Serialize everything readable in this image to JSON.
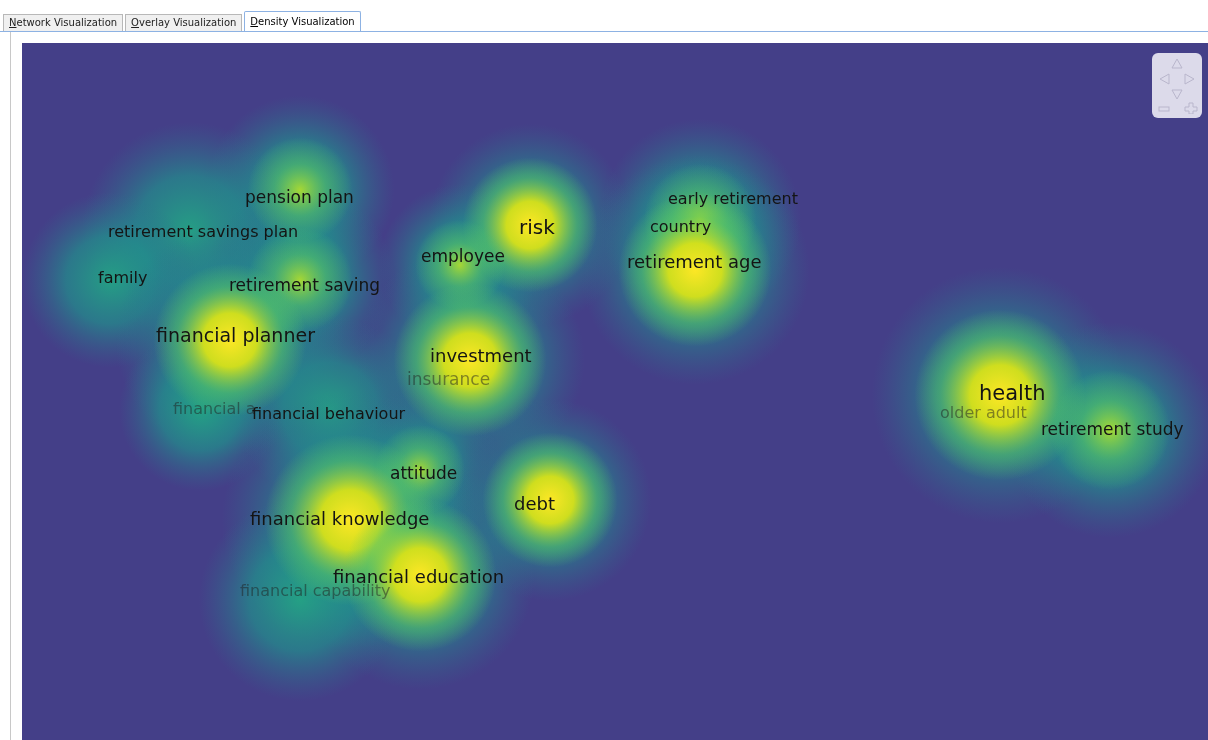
{
  "tabs": [
    {
      "label": "Network Visualization",
      "selected": false
    },
    {
      "label": "Overlay Visualization",
      "selected": false
    },
    {
      "label": "Density Visualization",
      "selected": true
    }
  ],
  "density_map": {
    "labels": [
      {
        "text": "pension plan",
        "kind": "normal"
      },
      {
        "text": "retirement savings plan",
        "kind": "normal"
      },
      {
        "text": "family",
        "kind": "normal"
      },
      {
        "text": "retirement saving",
        "kind": "normal"
      },
      {
        "text": "financial planner",
        "kind": "normal"
      },
      {
        "text": "financial a",
        "kind": "faint"
      },
      {
        "text": "financial behaviour",
        "kind": "normal"
      },
      {
        "text": "employee",
        "kind": "normal"
      },
      {
        "text": "risk",
        "kind": "normal"
      },
      {
        "text": "investment",
        "kind": "normal"
      },
      {
        "text": "insurance",
        "kind": "faint"
      },
      {
        "text": "attitude",
        "kind": "normal"
      },
      {
        "text": "financial knowledge",
        "kind": "normal"
      },
      {
        "text": "debt",
        "kind": "normal"
      },
      {
        "text": "financial education",
        "kind": "normal"
      },
      {
        "text": "financial capability",
        "kind": "faint"
      },
      {
        "text": "early retirement",
        "kind": "normal"
      },
      {
        "text": "country",
        "kind": "normal"
      },
      {
        "text": "retirement age",
        "kind": "normal"
      },
      {
        "text": "health",
        "kind": "normal"
      },
      {
        "text": "older adult",
        "kind": "faint"
      },
      {
        "text": "retirement study",
        "kind": "normal"
      }
    ]
  }
}
